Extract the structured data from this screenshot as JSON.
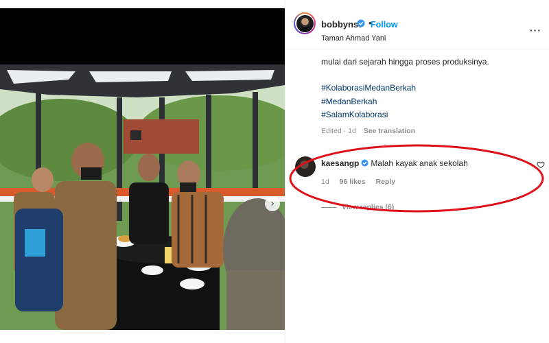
{
  "post": {
    "username": "bobbynst",
    "follow_label": "Follow",
    "separator": "•",
    "location": "Taman Ahmad Yani",
    "more_icon": "more-horizontal-icon"
  },
  "caption": {
    "line": "mulai dari sejarah hingga proses produksinya.",
    "hashtags": [
      "#KolaborasiMedanBerkah",
      "#MedanBerkah",
      "#SalamKolaborasi"
    ],
    "edited": "Edited · 1d",
    "see_translation": "See translation"
  },
  "comment": {
    "username": "kaesangp",
    "text": "Malah kayak anak sekolah",
    "time": "1d",
    "likes": "96 likes",
    "reply": "Reply",
    "view_replies": "View replies (6)"
  },
  "colors": {
    "follow": "#0095f6",
    "hashtag": "#00376b",
    "verified": "#3897f0",
    "annotation": "#e0101a"
  }
}
